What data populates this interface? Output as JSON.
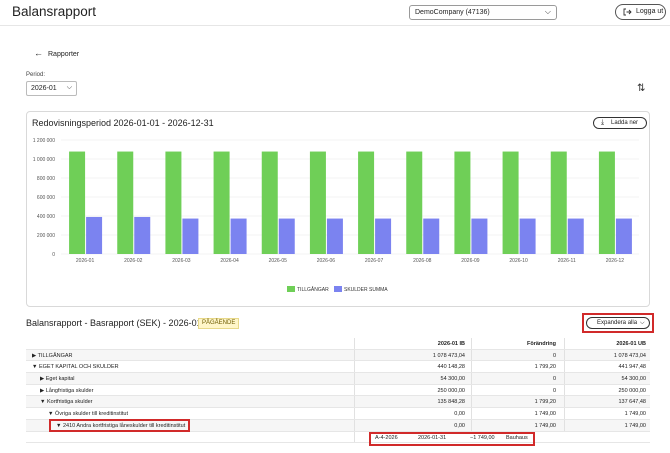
{
  "header": {
    "app_title": "Balansrapport",
    "company": "DemoCompany (47136)",
    "logout_label": "Logga ut"
  },
  "nav": {
    "back_label": "Rapporter"
  },
  "period": {
    "label": "Period:",
    "value": "2026-01"
  },
  "chart_card": {
    "title": "Redovisningsperiod 2026-01-01 - 2026-12-31",
    "download_label": "Ladda ner"
  },
  "chart_data": {
    "type": "bar",
    "categories": [
      "2026-01",
      "2026-02",
      "2026-03",
      "2026-04",
      "2026-05",
      "2026-06",
      "2026-07",
      "2026-08",
      "2026-09",
      "2026-10",
      "2026-11",
      "2026-12"
    ],
    "series": [
      {
        "name": "TILLGÅNGAR",
        "color": "#6fcf57",
        "values": [
          1078473,
          1078473,
          1078473,
          1078473,
          1078473,
          1078473,
          1078473,
          1078473,
          1078473,
          1078473,
          1078473,
          1078473
        ]
      },
      {
        "name": "SKULDER SUMMA",
        "color": "#7b83f0",
        "values": [
          390000,
          390000,
          373000,
          373000,
          373000,
          373000,
          373000,
          373000,
          373000,
          373000,
          373000,
          373000
        ]
      }
    ],
    "yticks": [
      "0",
      "200 000",
      "400 000",
      "600 000",
      "800 000",
      "1 000 000",
      "1 200 000"
    ],
    "ylim": [
      0,
      1200000
    ],
    "grid": true,
    "legend": "bottom-center"
  },
  "balance": {
    "title": "Balansrapport - Basrapport (SEK) - 2026-01",
    "status": "PÅGÅENDE",
    "expand_label": "Expandera alla",
    "columns": [
      "2026-01 IB",
      "Förändring",
      "2026-01 UB"
    ],
    "rows": [
      {
        "name": "▶ TILLGÅNGAR",
        "ib": "1 078 473,04",
        "change": "0",
        "ub": "1 078 473,04"
      },
      {
        "name": "▼ EGET KAPITAL OCH SKULDER",
        "ib": "440 148,28",
        "change": "1 799,20",
        "ub": "441 947,48"
      },
      {
        "name": "▶ Eget kapital",
        "ib": "54 300,00",
        "change": "0",
        "ub": "54 300,00"
      },
      {
        "name": "▶ Långfristiga skulder",
        "ib": "250 000,00",
        "change": "0",
        "ub": "250 000,00"
      },
      {
        "name": "▼ Kortfristiga skulder",
        "ib": "135 848,28",
        "change": "1 799,20",
        "ub": "137 647,48"
      },
      {
        "name": "▼ Övriga skulder till kreditinstitut",
        "ib": "0,00",
        "change": "1 749,00",
        "ub": "1 749,00"
      },
      {
        "name": "▼ 2410 Andra kortfristiga låneskulder till kreditinstitut",
        "ib": "0,00",
        "change": "1 749,00",
        "ub": "1 749,00"
      }
    ],
    "detail": {
      "ref": "A-4-2026",
      "date": "2026-01-31",
      "amount": "−1 749,00",
      "party": "Bauhaus"
    }
  }
}
